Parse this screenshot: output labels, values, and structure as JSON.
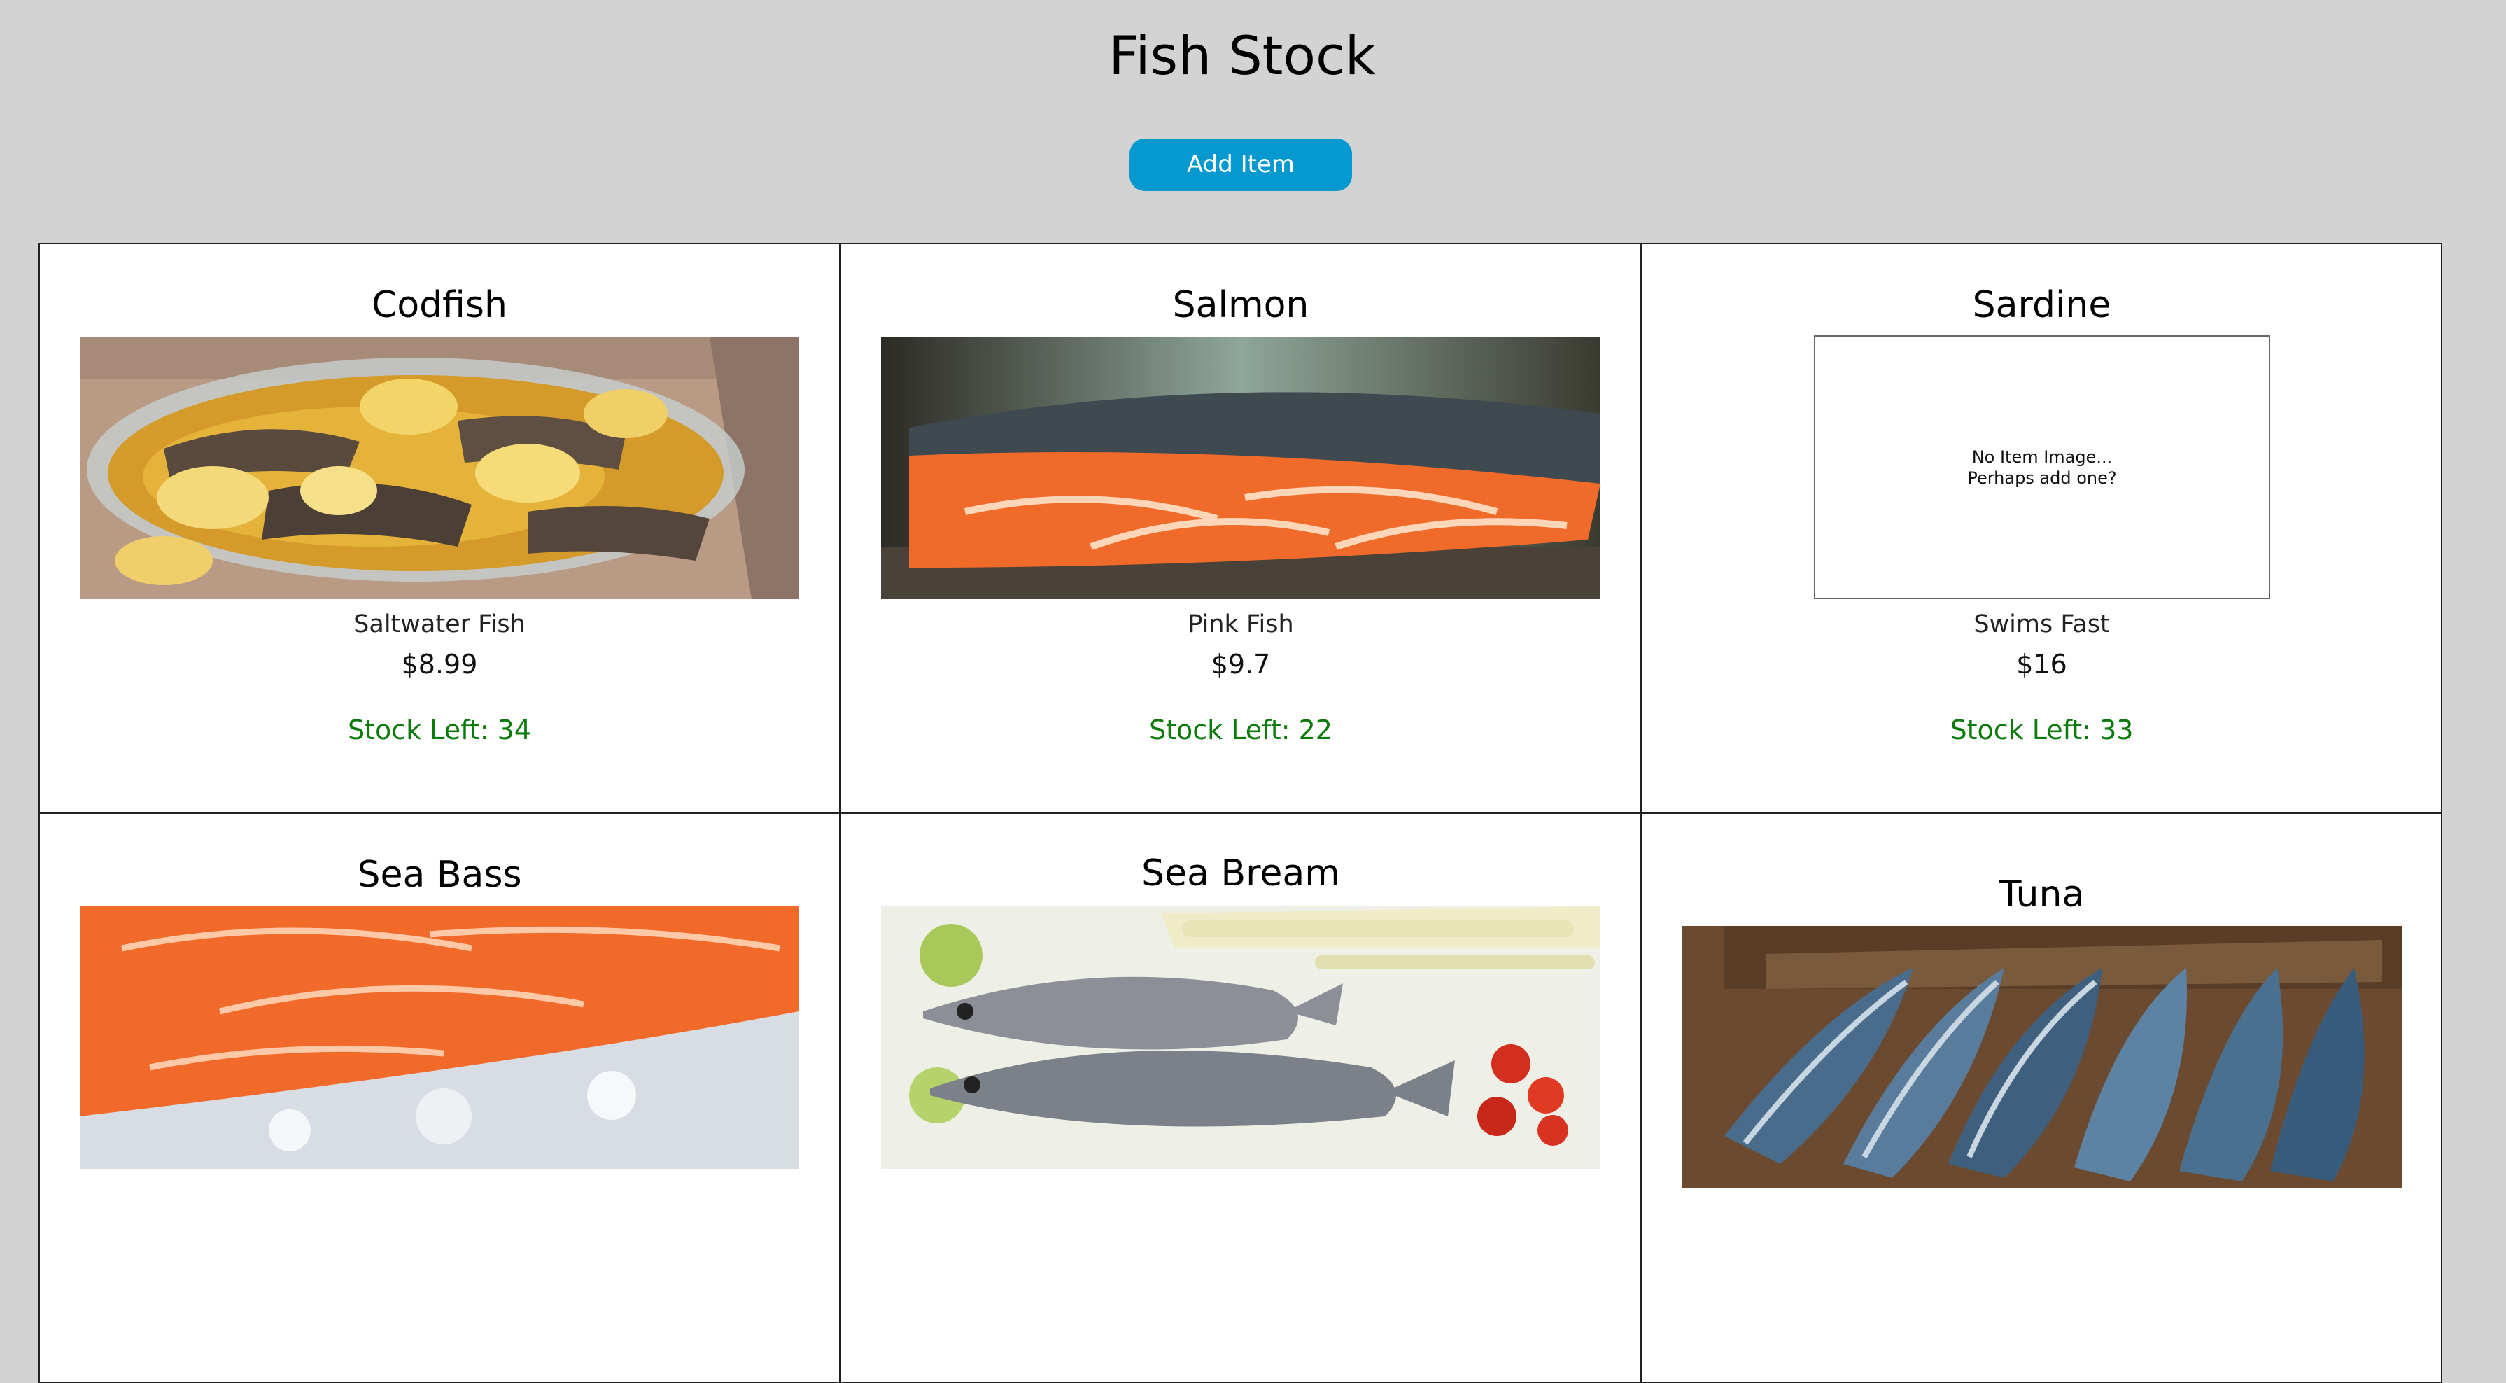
{
  "header": {
    "title": "Fish Stock",
    "add_label": "Add Item"
  },
  "items": [
    {
      "name": "Codfish",
      "description": "Saltwater Fish",
      "price": "$8.99",
      "stock": "Stock Left: 34",
      "image": "codfish-photo"
    },
    {
      "name": "Salmon",
      "description": "Pink Fish",
      "price": "$9.7",
      "stock": "Stock Left: 22",
      "image": "salmon-photo"
    },
    {
      "name": "Sardine",
      "description": "Swims Fast",
      "price": "$16",
      "stock": "Stock Left: 33",
      "image": null,
      "placeholder_line1": "No Item Image...",
      "placeholder_line2": "Perhaps add one?"
    },
    {
      "name": "Sea Bass",
      "image": "sea-bass-photo"
    },
    {
      "name": "Sea Bream",
      "image": "sea-bream-photo"
    },
    {
      "name": "Tuna",
      "image": "tuna-photo"
    }
  ],
  "colors": {
    "background": "#d3d3d3",
    "button": "#0599cf",
    "stock_text": "#0a7a0a"
  }
}
